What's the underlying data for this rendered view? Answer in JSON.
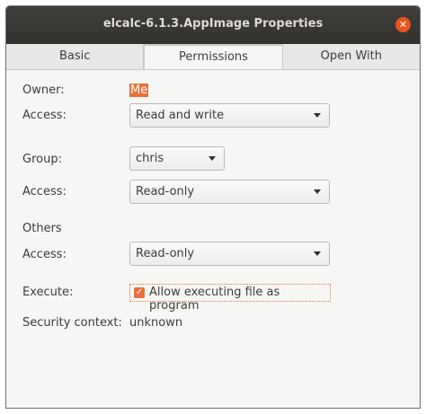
{
  "window": {
    "title": "elcalc-6.1.3.AppImage Properties",
    "close_glyph": "✕"
  },
  "tabs": [
    {
      "label": "Basic"
    },
    {
      "label": "Permissions"
    },
    {
      "label": "Open With"
    }
  ],
  "permissions": {
    "owner_label": "Owner:",
    "owner_value": "Me",
    "owner_access_label": "Access:",
    "owner_access_value": "Read and write",
    "group_label": "Group:",
    "group_value": "chris",
    "group_access_label": "Access:",
    "group_access_value": "Read-only",
    "others_label": "Others",
    "others_access_label": "Access:",
    "others_access_value": "Read-only",
    "execute_label": "Execute:",
    "execute_checked": true,
    "execute_checkbox_label": "Allow executing file as program",
    "security_context_label": "Security context:",
    "security_context_value": "unknown"
  },
  "colors": {
    "accent": "#e8703a",
    "close_button": "#e95420",
    "titlebar": "#3a3936"
  }
}
